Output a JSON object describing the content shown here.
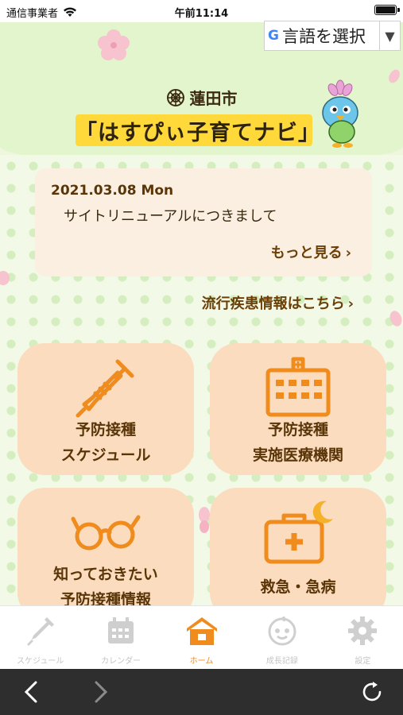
{
  "status_bar": {
    "carrier": "通信事業者",
    "time": "午前11:14"
  },
  "translate": {
    "label": "言語を選択",
    "arrow": "▼"
  },
  "header": {
    "city": "蓮田市",
    "app_title": "「はすぴぃ子育てナビ」"
  },
  "news": {
    "date": "2021.03.08 Mon",
    "headline": "サイトリニューアルにつきまして",
    "more_label": "もっと見る"
  },
  "disease_link": "流行疾患情報はこちら",
  "tiles": [
    {
      "line1": "予防接種",
      "line2": "スケジュール",
      "icon": "syringe-icon"
    },
    {
      "line1": "予防接種",
      "line2": "実施医療機関",
      "icon": "hospital-building-icon"
    },
    {
      "line1": "知っておきたい",
      "line2": "予防接種情報",
      "icon": "glasses-icon"
    },
    {
      "line1": "救急・急病",
      "line2": "",
      "icon": "first-aid-night-icon"
    }
  ],
  "tabbar": {
    "items": [
      {
        "label": "スケジュール",
        "icon": "syringe-icon",
        "active": false
      },
      {
        "label": "カレンダー",
        "icon": "calendar-icon",
        "active": false
      },
      {
        "label": "ホーム",
        "icon": "home-icon",
        "active": true
      },
      {
        "label": "成長記録",
        "icon": "baby-face-icon",
        "active": false
      },
      {
        "label": "設定",
        "icon": "gear-icon",
        "active": false
      }
    ]
  },
  "colors": {
    "accent": "#f08c1e",
    "tile_bg": "#fbdcbe",
    "banner": "#ffd93a",
    "header_bg": "#e3f5cc"
  }
}
